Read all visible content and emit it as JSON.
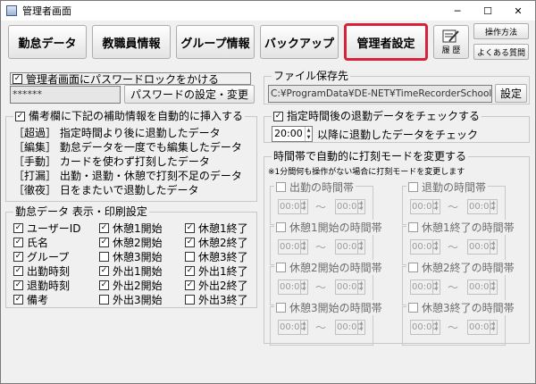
{
  "window": {
    "title": "管理者画面",
    "minimize": "─",
    "maximize": "☐",
    "close": "✕"
  },
  "toolbar": {
    "tabs": [
      "勤怠データ",
      "教職員情報",
      "グループ情報",
      "バックアップ",
      "管理者設定"
    ],
    "active_tab": "管理者設定",
    "history_label": "履 歴",
    "help_label": "操作方法",
    "faq_label": "よくある質問"
  },
  "password": {
    "checkbox_label": "管理者画面にパスワードロックをかける",
    "checked": true,
    "value": "******",
    "button": "パスワードの設定・変更"
  },
  "remarks": {
    "checkbox_label": "備考欄に下記の補助情報を自動的に挿入する",
    "checked": true,
    "items": [
      "［超過］ 指定時間より後に退勤したデータ",
      "［編集］ 勤怠データを一度でも編集したデータ",
      "［手動］ カードを使わず打刻したデータ",
      "［打漏］ 出勤・退勤・休憩で打刻不足のデータ",
      "［徹夜］ 日をまたいで退勤したデータ"
    ]
  },
  "display": {
    "title": "勤怠データ 表示・印刷設定",
    "columns": [
      [
        {
          "label": "ユーザーID",
          "checked": true
        },
        {
          "label": "氏名",
          "checked": true
        },
        {
          "label": "グループ",
          "checked": true
        },
        {
          "label": "出勤時刻",
          "checked": true
        },
        {
          "label": "退勤時刻",
          "checked": true
        },
        {
          "label": "備考",
          "checked": true
        }
      ],
      [
        {
          "label": "休憩1開始",
          "checked": true
        },
        {
          "label": "休憩2開始",
          "checked": true
        },
        {
          "label": "休憩3開始",
          "checked": false
        },
        {
          "label": "外出1開始",
          "checked": true
        },
        {
          "label": "外出2開始",
          "checked": true
        },
        {
          "label": "外出3開始",
          "checked": false
        }
      ],
      [
        {
          "label": "休憩1終了",
          "checked": true
        },
        {
          "label": "休憩2終了",
          "checked": true
        },
        {
          "label": "休憩3終了",
          "checked": false
        },
        {
          "label": "外出1終了",
          "checked": true
        },
        {
          "label": "外出2終了",
          "checked": true
        },
        {
          "label": "外出3終了",
          "checked": false
        }
      ]
    ]
  },
  "file_save": {
    "title": "ファイル保存先",
    "path": "C:¥ProgramData¥DE-NET¥TimeRecorderSchool",
    "button": "設定"
  },
  "late_check": {
    "checkbox_label": "指定時間後の退勤データをチェックする",
    "checked": true,
    "time": "20:00",
    "suffix": "以降に退勤したデータをチェック"
  },
  "auto_mode": {
    "title": "時間帯で自動的に打刻モードを変更する",
    "note": "※1分間何も操作がない場合に打刻モードを変更します",
    "boxes": [
      {
        "label": "出勤の時間帯",
        "from": "00:00",
        "to": "00:00"
      },
      {
        "label": "退勤の時間帯",
        "from": "00:00",
        "to": "00:00"
      },
      {
        "label": "休憩1開始の時間帯",
        "from": "00:00",
        "to": "00:00"
      },
      {
        "label": "休憩1終了の時間帯",
        "from": "00:00",
        "to": "00:00"
      },
      {
        "label": "休憩2開始の時間帯",
        "from": "00:00",
        "to": "00:00"
      },
      {
        "label": "休憩2終了の時間帯",
        "from": "00:00",
        "to": "00:00"
      },
      {
        "label": "休憩3開始の時間帯",
        "from": "00:00",
        "to": "00:00"
      },
      {
        "label": "休憩3終了の時間帯",
        "from": "00:00",
        "to": "00:00"
      }
    ],
    "tilde": "〜"
  },
  "colors": {
    "active_border": "#d6233a",
    "window_bg": "#f0f0f0"
  }
}
